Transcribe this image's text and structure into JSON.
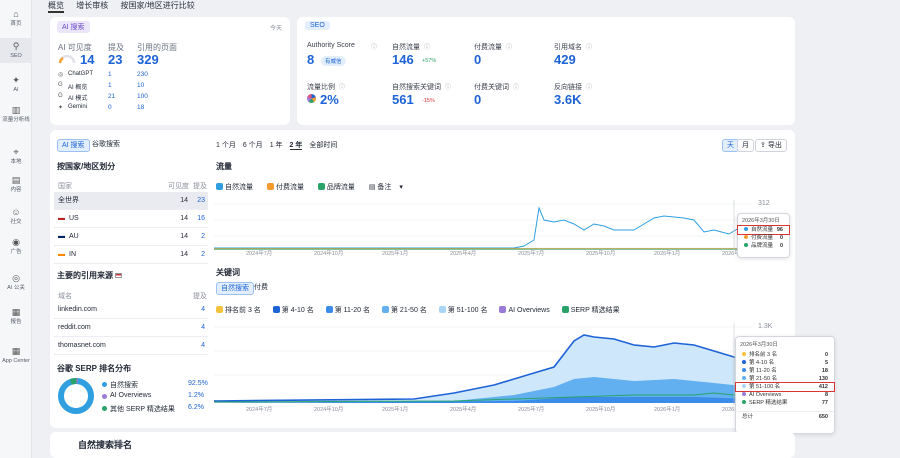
{
  "sidebar": [
    {
      "label": "首页",
      "icon": "home-icon"
    },
    {
      "label": "SEO",
      "icon": "seo-icon",
      "active": true
    },
    {
      "label": "AI",
      "icon": "ai-icon"
    },
    {
      "label": "流量分析线",
      "icon": "traffic-icon"
    },
    {
      "label": "本地",
      "icon": "local-icon"
    },
    {
      "label": "内容",
      "icon": "content-icon"
    },
    {
      "label": "社交",
      "icon": "social-icon"
    },
    {
      "label": "广告",
      "icon": "ads-icon"
    },
    {
      "label": "AI 公关",
      "icon": "ai-pr-icon"
    },
    {
      "label": "报告",
      "icon": "report-icon"
    },
    {
      "label": "App Center",
      "icon": "app-center-icon"
    }
  ],
  "topnav": [
    "概览",
    "增长审核",
    "按国家/地区进行比较"
  ],
  "ai_card": {
    "tag": "AI 搜索",
    "date": "今天",
    "h_visibility": "AI 可见度",
    "h_mentions": "提及",
    "h_pages": "引用的页面",
    "visibility": "14",
    "mentions": "23",
    "pages": "329",
    "rows": [
      {
        "name": "ChatGPT",
        "a": "1",
        "b": "230"
      },
      {
        "name": "AI 概览",
        "a": "1",
        "b": "10"
      },
      {
        "name": "AI 模式",
        "a": "21",
        "b": "100"
      },
      {
        "name": "Gemini",
        "a": "0",
        "b": "18"
      }
    ]
  },
  "seo_card": {
    "tag": "SEO",
    "metrics": [
      {
        "label": "Authority Score",
        "value": "8",
        "badge": "有威信"
      },
      {
        "label": "自然流量",
        "value": "146",
        "delta": "+57%"
      },
      {
        "label": "付费流量",
        "value": "0"
      },
      {
        "label": "引用域名",
        "value": "429"
      },
      {
        "label": "流量比例",
        "value": "2%"
      },
      {
        "label": "自然搜索关键词",
        "value": "561",
        "delta": "-15%"
      },
      {
        "label": "付费关键词",
        "value": "0"
      },
      {
        "label": "反向链接",
        "value": "3.6K"
      }
    ]
  },
  "tabs": {
    "ai": "AI 搜索",
    "google": "谷歌搜索"
  },
  "country": {
    "title": "按国家/地区划分",
    "h_country": "国家",
    "h_vis": "可见度",
    "h_men": "提及",
    "rows": [
      {
        "name": "全世界",
        "vis": "14",
        "men": "23"
      },
      {
        "name": "US",
        "vis": "14",
        "men": "16"
      },
      {
        "name": "AU",
        "vis": "14",
        "men": "2"
      },
      {
        "name": "IN",
        "vis": "14",
        "men": "2"
      }
    ]
  },
  "sources": {
    "title": "主要的引用来源",
    "h_domain": "域名",
    "h_men": "提及",
    "rows": [
      {
        "name": "linkedin.com",
        "men": "4"
      },
      {
        "name": "reddit.com",
        "men": "4"
      },
      {
        "name": "thomasnet.com",
        "men": "4"
      }
    ]
  },
  "serp": {
    "title": "谷歌 SERP 排名分布",
    "rows": [
      {
        "name": "自然搜索",
        "pct": "92.5%",
        "color": "#2f9fe0"
      },
      {
        "name": "AI Overviews",
        "pct": "1.2%",
        "color": "#9b7bd8"
      },
      {
        "name": "其他 SERP 精选结果",
        "pct": "6.2%",
        "color": "#2aa36a"
      }
    ]
  },
  "periods": [
    "1 个月",
    "6 个月",
    "1 年",
    "2 年",
    "全部时间"
  ],
  "toolbar": {
    "day": "天",
    "month": "月",
    "export": "导出"
  },
  "traffic": {
    "title": "流量",
    "legend": [
      "自然流量",
      "付费流量",
      "品牌流量"
    ],
    "note": "备注",
    "ymax": "312",
    "xlabels": [
      "2024年7月",
      "2024年10月",
      "2025年1月",
      "2025年4月",
      "2025年7月",
      "2025年10月",
      "2026年1月",
      "2026年"
    ]
  },
  "traffic_tip": {
    "date": "2026年3月30日",
    "rows": [
      {
        "name": "自然流量",
        "val": "96",
        "color": "#2f9fe0"
      },
      {
        "name": "付费流量",
        "val": "0",
        "color": "#f39b2e"
      },
      {
        "name": "品牌流量",
        "val": "0",
        "color": "#2aa36a"
      }
    ]
  },
  "keywords": {
    "title": "关键词",
    "tab1": "自然搜索",
    "tab2": "付费",
    "legend": [
      "排名前 3 名",
      "第 4-10 名",
      "第 11-20 名",
      "第 21-50 名",
      "第 51-100 名",
      "AI Overviews",
      "SERP 精选结果"
    ],
    "ymax": "1.3K",
    "xlabels": [
      "2024年7月",
      "2024年10月",
      "2025年1月",
      "2025年4月",
      "2025年7月",
      "2025年10月",
      "2026年1月",
      "2026年"
    ]
  },
  "kw_tip": {
    "date": "2026年3月30日",
    "rows": [
      {
        "name": "排名前 3 名",
        "val": "0",
        "color": "#f3c23e"
      },
      {
        "name": "第 4-10 名",
        "val": "5",
        "color": "#1d63d6"
      },
      {
        "name": "第 11-20 名",
        "val": "18",
        "color": "#3b8ce8"
      },
      {
        "name": "第 21-50 名",
        "val": "130",
        "color": "#62b0ef"
      },
      {
        "name": "第 51-100 名",
        "val": "412",
        "color": "#a8d6f7"
      },
      {
        "name": "AI Overviews",
        "val": "8",
        "color": "#9b7bd8"
      },
      {
        "name": "SERP 精选结果",
        "val": "77",
        "color": "#2aa36a"
      }
    ],
    "total_label": "总计",
    "total": "650"
  },
  "bottom": {
    "title": "自然搜索排名",
    "flag": "US"
  },
  "colors": {
    "accent": "#1d63d6",
    "organic": "#2f9fe0",
    "paid": "#f39b2e",
    "brand": "#2aa36a",
    "highlight": "#d93636"
  }
}
